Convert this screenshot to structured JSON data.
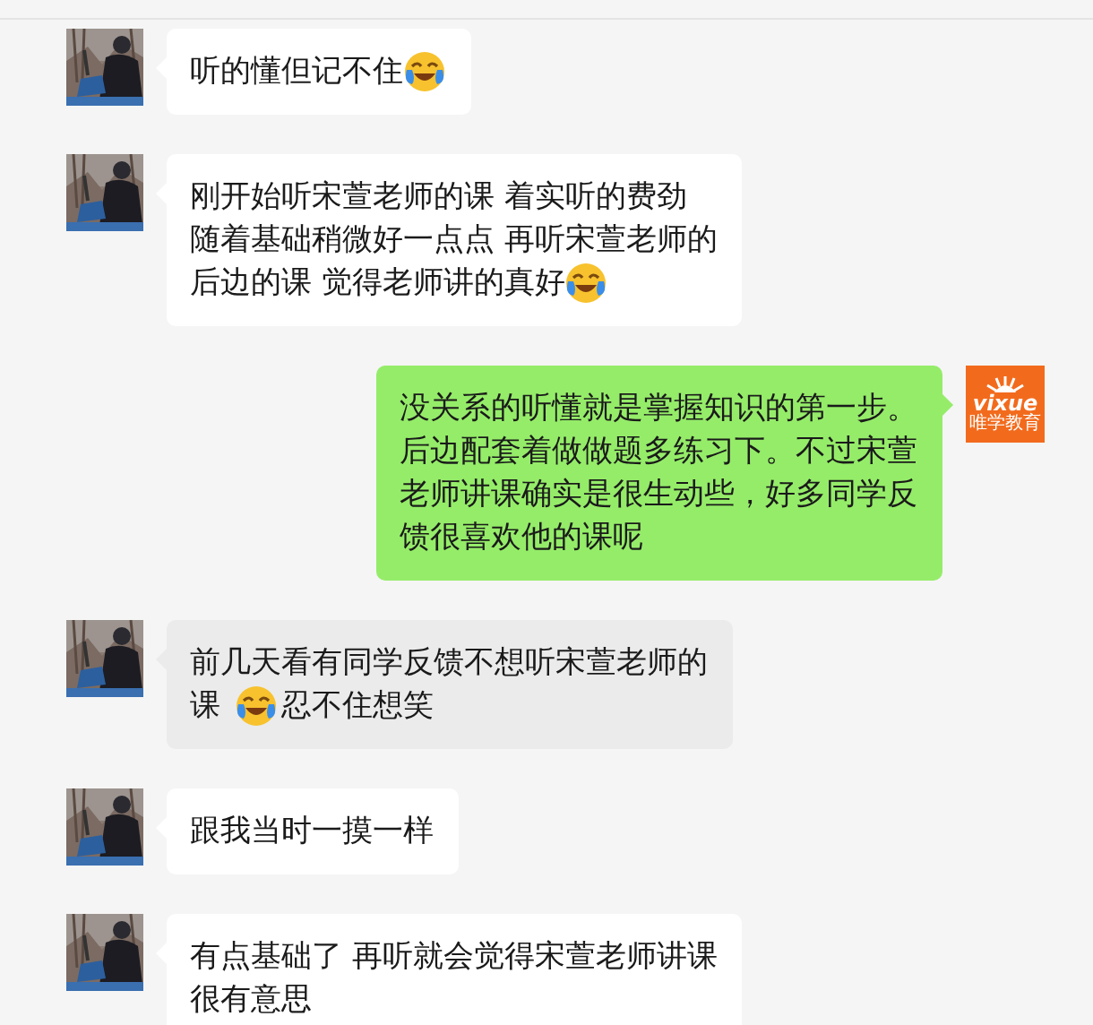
{
  "messages": [
    {
      "kind": "received",
      "highlighted": false,
      "lines": [
        [
          {
            "kind": "text",
            "text": "听的懂但记不住"
          },
          {
            "kind": "emoji"
          }
        ]
      ]
    },
    {
      "kind": "received",
      "highlighted": false,
      "lines": [
        [
          {
            "kind": "text",
            "text": "刚开始听宋萱老师的课 着实听的费劲"
          }
        ],
        [
          {
            "kind": "text",
            "text": "随着基础稍微好一点点 再听宋萱老师的"
          }
        ],
        [
          {
            "kind": "text",
            "text": "后边的课 觉得老师讲的真好"
          },
          {
            "kind": "emoji"
          }
        ]
      ]
    },
    {
      "kind": "sent",
      "highlighted": false,
      "logo": {
        "text": "vixue",
        "subtitle": "唯学教育"
      },
      "lines": [
        [
          {
            "kind": "text",
            "text": "没关系的听懂就是掌握知识的第一步。"
          }
        ],
        [
          {
            "kind": "text",
            "text": "后边配套着做做题多练习下。不过宋萱"
          }
        ],
        [
          {
            "kind": "text",
            "text": "老师讲课确实是很生动些，好多同学反"
          }
        ],
        [
          {
            "kind": "text",
            "text": "馈很喜欢他的课呢"
          }
        ]
      ]
    },
    {
      "kind": "received",
      "highlighted": true,
      "lines": [
        [
          {
            "kind": "text",
            "text": "前几天看有同学反馈不想听宋萱老师的"
          }
        ],
        [
          {
            "kind": "text",
            "text": "课"
          },
          {
            "kind": "emoji"
          },
          {
            "kind": "text",
            "text": "忍不住想笑"
          }
        ]
      ]
    },
    {
      "kind": "received",
      "highlighted": false,
      "lines": [
        [
          {
            "kind": "text",
            "text": "跟我当时一摸一样"
          }
        ]
      ]
    },
    {
      "kind": "received",
      "highlighted": false,
      "lines": [
        [
          {
            "kind": "text",
            "text": "有点基础了 再听就会觉得宋萱老师讲课"
          }
        ],
        [
          {
            "kind": "text",
            "text": "很有意思"
          }
        ]
      ]
    }
  ]
}
